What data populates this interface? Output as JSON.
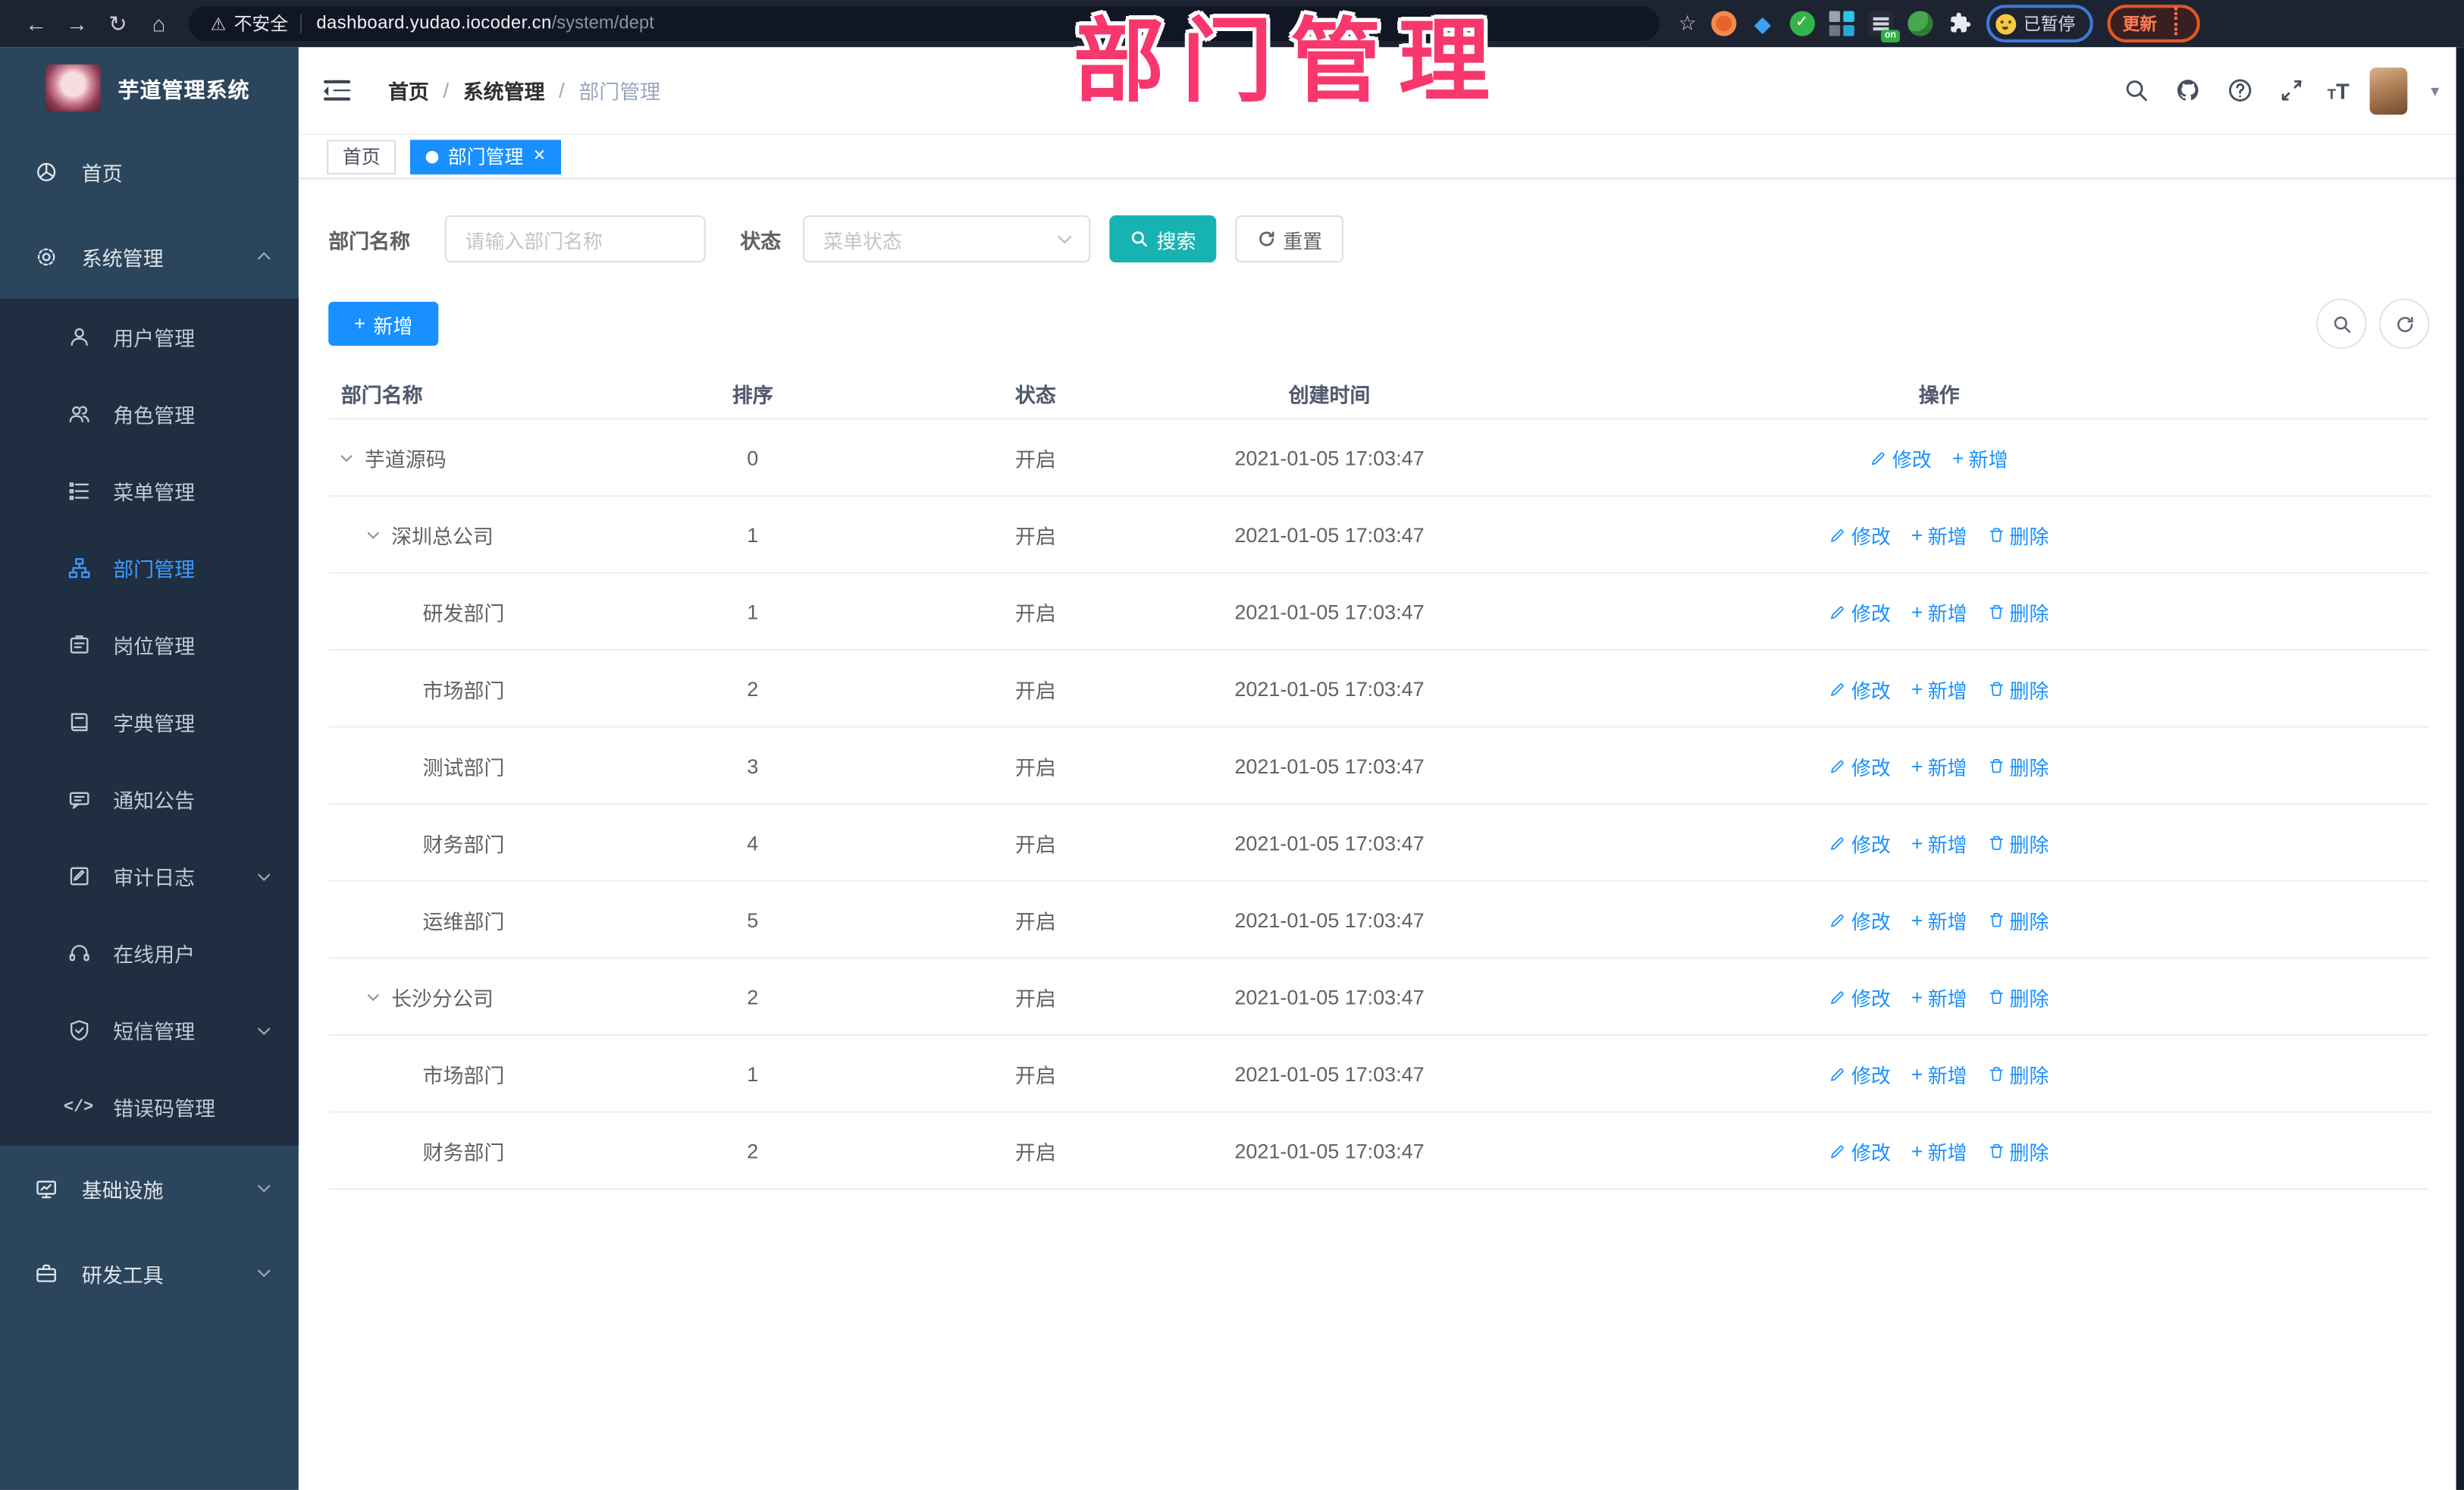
{
  "browser": {
    "security_label": "不安全",
    "url_host": "dashboard.yudao.iocoder.cn",
    "url_path": "/system/dept",
    "profile_label": "已暂停",
    "update_label": "更新"
  },
  "overlay_title": "部门管理",
  "sidebar": {
    "app_title": "芋道管理系统",
    "items": [
      {
        "key": "home",
        "label": "首页",
        "icon": "dashboard-icon",
        "level": 1
      },
      {
        "key": "system-management",
        "label": "系统管理",
        "icon": "gear-icon",
        "level": 1,
        "chevron": "up"
      },
      {
        "key": "user-management",
        "label": "用户管理",
        "icon": "user-icon",
        "level": 2
      },
      {
        "key": "role-management",
        "label": "角色管理",
        "icon": "users-icon",
        "level": 2
      },
      {
        "key": "menu-management",
        "label": "菜单管理",
        "icon": "menu-list-icon",
        "level": 2
      },
      {
        "key": "dept-management",
        "label": "部门管理",
        "icon": "org-tree-icon",
        "level": 2,
        "active": true
      },
      {
        "key": "post-management",
        "label": "岗位管理",
        "icon": "badge-icon",
        "level": 2
      },
      {
        "key": "dict-management",
        "label": "字典管理",
        "icon": "dictionary-icon",
        "level": 2
      },
      {
        "key": "notice-announcement",
        "label": "通知公告",
        "icon": "announcement-icon",
        "level": 2
      },
      {
        "key": "audit-log",
        "label": "审计日志",
        "icon": "audit-log-icon",
        "level": 2,
        "chevron": "down"
      },
      {
        "key": "online-users",
        "label": "在线用户",
        "icon": "headset-icon",
        "level": 2
      },
      {
        "key": "sms-management",
        "label": "短信管理",
        "icon": "shield-check-icon",
        "level": 2,
        "chevron": "down"
      },
      {
        "key": "error-code-management",
        "label": "错误码管理",
        "icon": "code-icon",
        "level": 2
      },
      {
        "key": "infrastructure",
        "label": "基础设施",
        "icon": "monitor-icon",
        "level": 1,
        "chevron": "down"
      },
      {
        "key": "dev-tools",
        "label": "研发工具",
        "icon": "toolbox-icon",
        "level": 1,
        "chevron": "down"
      }
    ]
  },
  "header": {
    "breadcrumb": [
      "首页",
      "系统管理",
      "部门管理"
    ]
  },
  "tabs": [
    {
      "label": "首页",
      "active": false
    },
    {
      "label": "部门管理",
      "active": true,
      "closable": true
    }
  ],
  "filters": {
    "name_label": "部门名称",
    "name_placeholder": "请输入部门名称",
    "status_label": "状态",
    "status_placeholder": "菜单状态",
    "search_label": "搜索",
    "reset_label": "重置"
  },
  "toolbar": {
    "add_label": "新增"
  },
  "table": {
    "columns": [
      "部门名称",
      "排序",
      "状态",
      "创建时间",
      "操作"
    ],
    "action_labels": {
      "edit": "修改",
      "add": "新增",
      "delete": "删除"
    },
    "rows": [
      {
        "name": "芋道源码",
        "level": 1,
        "expandable": true,
        "sort": "0",
        "status": "开启",
        "time": "2021-01-05 17:03:47",
        "actions": [
          "edit",
          "add"
        ]
      },
      {
        "name": "深圳总公司",
        "level": 2,
        "expandable": true,
        "sort": "1",
        "status": "开启",
        "time": "2021-01-05 17:03:47",
        "actions": [
          "edit",
          "add",
          "delete"
        ]
      },
      {
        "name": "研发部门",
        "level": 3,
        "expandable": false,
        "sort": "1",
        "status": "开启",
        "time": "2021-01-05 17:03:47",
        "actions": [
          "edit",
          "add",
          "delete"
        ]
      },
      {
        "name": "市场部门",
        "level": 3,
        "expandable": false,
        "sort": "2",
        "status": "开启",
        "time": "2021-01-05 17:03:47",
        "actions": [
          "edit",
          "add",
          "delete"
        ]
      },
      {
        "name": "测试部门",
        "level": 3,
        "expandable": false,
        "sort": "3",
        "status": "开启",
        "time": "2021-01-05 17:03:47",
        "actions": [
          "edit",
          "add",
          "delete"
        ]
      },
      {
        "name": "财务部门",
        "level": 3,
        "expandable": false,
        "sort": "4",
        "status": "开启",
        "time": "2021-01-05 17:03:47",
        "actions": [
          "edit",
          "add",
          "delete"
        ]
      },
      {
        "name": "运维部门",
        "level": 3,
        "expandable": false,
        "sort": "5",
        "status": "开启",
        "time": "2021-01-05 17:03:47",
        "actions": [
          "edit",
          "add",
          "delete"
        ]
      },
      {
        "name": "长沙分公司",
        "level": 2,
        "expandable": true,
        "sort": "2",
        "status": "开启",
        "time": "2021-01-05 17:03:47",
        "actions": [
          "edit",
          "add",
          "delete"
        ]
      },
      {
        "name": "市场部门",
        "level": 3,
        "expandable": false,
        "sort": "1",
        "status": "开启",
        "time": "2021-01-05 17:03:47",
        "actions": [
          "edit",
          "add",
          "delete"
        ]
      },
      {
        "name": "财务部门",
        "level": 3,
        "expandable": false,
        "sort": "2",
        "status": "开启",
        "time": "2021-01-05 17:03:47",
        "actions": [
          "edit",
          "add",
          "delete"
        ]
      }
    ]
  },
  "colors": {
    "primary_blue": "#1890ff",
    "search_teal": "#17b3b3",
    "overlay_pink": "#f8376d",
    "sidebar_bg": "#2b455c",
    "submenu_bg": "#1f2e41",
    "active_menu": "#3e9bff"
  }
}
